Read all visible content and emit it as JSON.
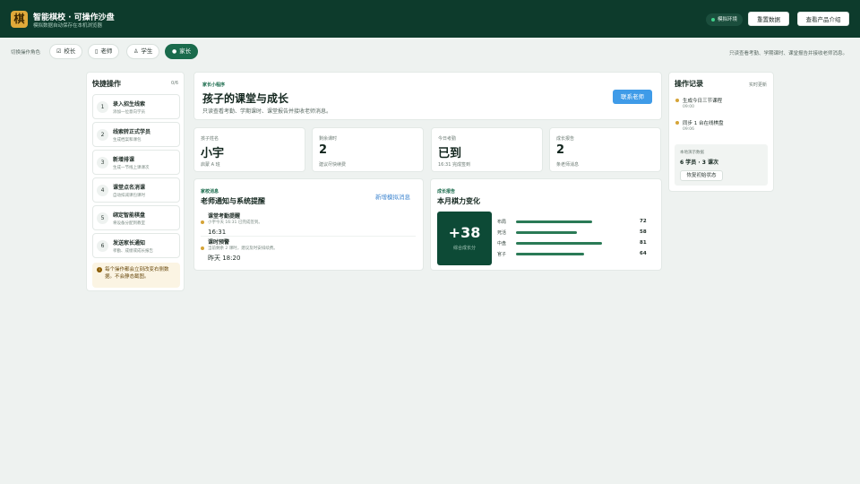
{
  "app": {
    "logo_char": "棋",
    "title": "智能棋校 · 可操作沙盘",
    "subtitle": "模拟数据自动保存在本机浏览器",
    "env_badge": "模拟环境",
    "reset_label": "重置数据",
    "intro_label": "查看产品介绍"
  },
  "roles": {
    "label": "切换操作角色",
    "items": [
      {
        "label": "校长",
        "icon": "checkbox-icon"
      },
      {
        "label": "老师",
        "icon": "book-icon"
      },
      {
        "label": "学生",
        "icon": "user-icon"
      },
      {
        "label": "家长",
        "icon": "user-icon",
        "active": true
      }
    ],
    "hint": "只读查看考勤、学期课时、课堂报告并接收老师消息。"
  },
  "quick": {
    "title": "快捷操作",
    "count": "0/6",
    "steps": [
      {
        "num": "1",
        "title": "录入招生线索",
        "desc": "添加一位意向学员"
      },
      {
        "num": "2",
        "title": "线索转正式学员",
        "desc": "生成档案和课包"
      },
      {
        "num": "3",
        "title": "新增排课",
        "desc": "生成一节线上课课次"
      },
      {
        "num": "4",
        "title": "课堂点名消课",
        "desc": "自动扣减课包课时"
      },
      {
        "num": "5",
        "title": "绑定智能棋盘",
        "desc": "将设备分配到教室"
      },
      {
        "num": "6",
        "title": "发送家长通知",
        "desc": "孝勤、成绩或成长报告"
      }
    ],
    "tip": "每个操作都会立刻改变右侧数据。不会静态截图。"
  },
  "hero": {
    "tag": "家长小程序",
    "title": "孩子的课堂与成长",
    "subtitle": "只读查看考勤、学期课时、课堂报告并接收老师消息。",
    "button": "联系老师"
  },
  "stats": [
    {
      "label": "孩子姓名",
      "value": "小宇",
      "sub": "启蒙 A 班"
    },
    {
      "label": "剩余课时",
      "value": "2",
      "sub": "建议尽快续费"
    },
    {
      "label": "今日考勤",
      "value": "已到",
      "sub": "16:31 完成签到"
    },
    {
      "label": "成长报告",
      "value": "2",
      "sub": "条老师消息"
    }
  ],
  "notices": {
    "tag": "家校消息",
    "title": "老师通知与系统提醒",
    "button": "新增模拟消息",
    "items": [
      {
        "title": "课堂考勤提醒",
        "desc": "小宇今天 16:31 已完成签到。",
        "time": "16:31"
      },
      {
        "title": "课时预警",
        "desc": "当前剩余 2 课时，建议及时安排续费。",
        "time": "昨天 18:20"
      }
    ]
  },
  "growth": {
    "tag": "成长报告",
    "title": "本月棋力变化",
    "score": "+38",
    "score_caption": "综合成长分",
    "bars": [
      {
        "label": "布局",
        "value": 72
      },
      {
        "label": "死活",
        "value": 58
      },
      {
        "label": "中盘",
        "value": 81
      },
      {
        "label": "官子",
        "value": 64
      }
    ]
  },
  "log": {
    "title": "操作记录",
    "live": "实时更新",
    "items": [
      {
        "text": "生成今日三节课程",
        "time": "09:00"
      },
      {
        "text": "同步 1 台在线棋盘",
        "time": "09:06"
      }
    ],
    "local_label": "本地演示数据",
    "local_value": "6 学员 · 3 课次",
    "reset_button": "恢复初始状态"
  }
}
